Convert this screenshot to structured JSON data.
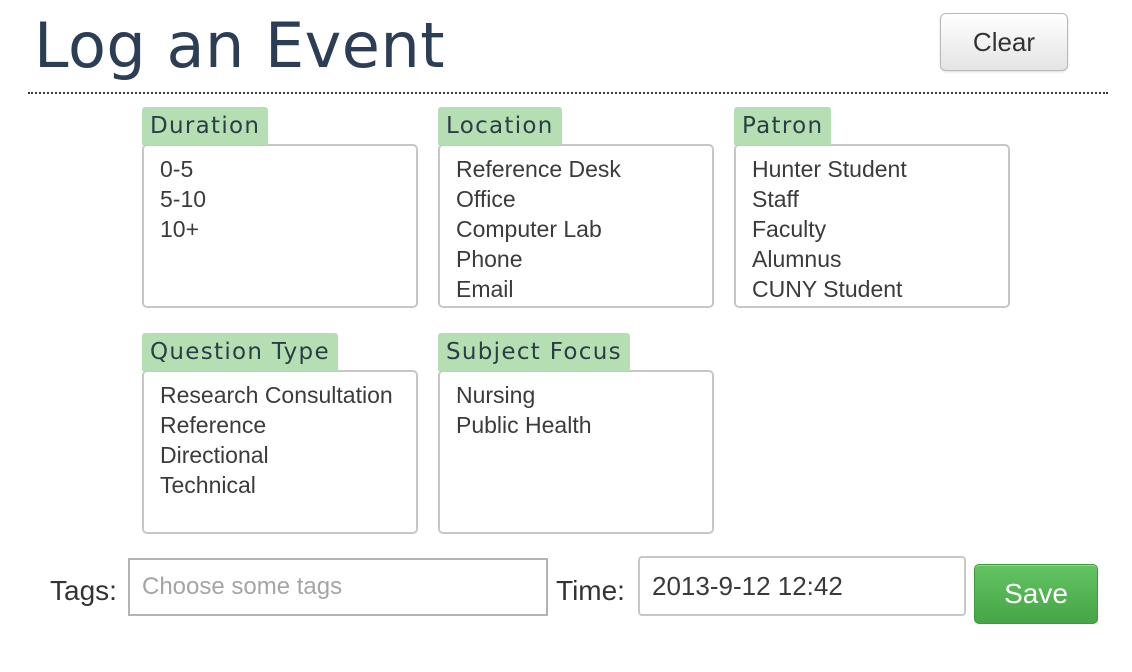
{
  "header": {
    "title": "Log an Event",
    "clear_label": "Clear"
  },
  "groups": {
    "duration": {
      "label": "Duration",
      "options": [
        "0-5",
        "5-10",
        "10+"
      ]
    },
    "location": {
      "label": "Location",
      "options": [
        "Reference Desk",
        "Office",
        "Computer Lab",
        "Phone",
        "Email"
      ]
    },
    "patron": {
      "label": "Patron",
      "options": [
        "Hunter Student",
        "Staff",
        "Faculty",
        "Alumnus",
        "CUNY Student"
      ]
    },
    "question_type": {
      "label": "Question Type",
      "options": [
        "Research Consultation",
        "Reference",
        "Directional",
        "Technical"
      ]
    },
    "subject_focus": {
      "label": "Subject Focus",
      "options": [
        "Nursing",
        "Public Health"
      ]
    }
  },
  "footer": {
    "tags_label": "Tags:",
    "tags_placeholder": "Choose some tags",
    "time_label": "Time:",
    "time_value": "2013-9-12 12:42",
    "save_label": "Save"
  },
  "colors": {
    "title": "#2c3e55",
    "group_label_bg": "#b5dfb3",
    "save_button": "#4cae4c"
  }
}
